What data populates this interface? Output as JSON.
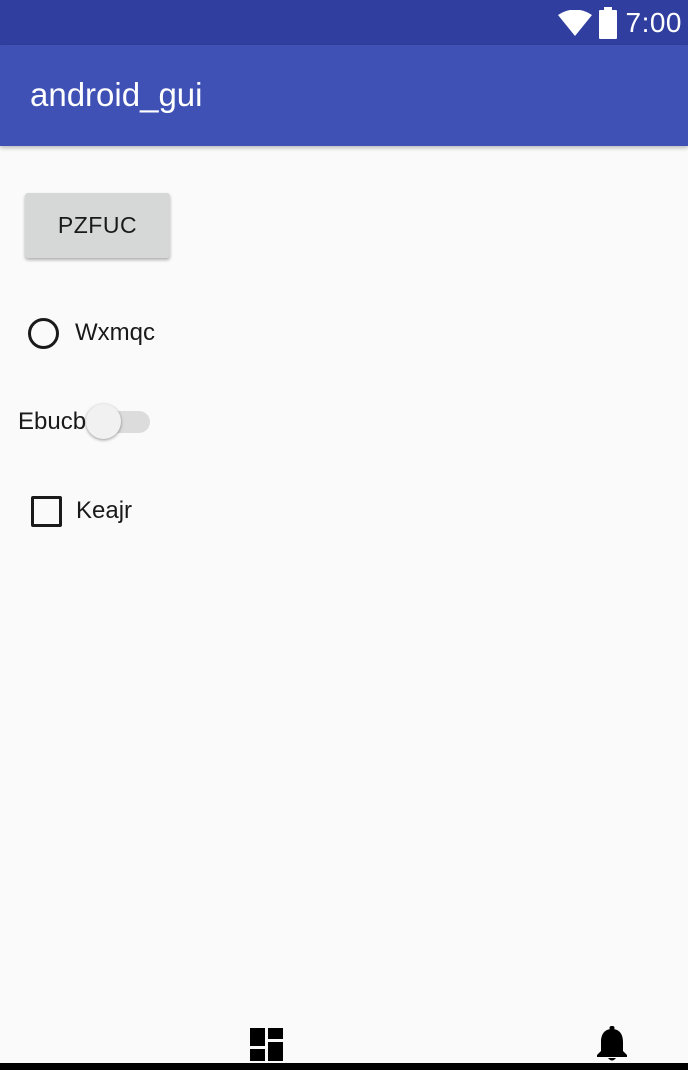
{
  "status_bar": {
    "time": "7:00",
    "icons": [
      "wifi-icon",
      "battery-icon"
    ],
    "background_color": "#303f9f"
  },
  "app_bar": {
    "title": "android_gui",
    "background_color": "#3f51b5"
  },
  "content": {
    "button_label": "PZFUC",
    "radio_label": "Wxmqc",
    "radio_checked": false,
    "switch_label": "Ebucb",
    "switch_on": false,
    "checkbox_label": "Keajr",
    "checkbox_checked": false
  },
  "bottom_nav": {
    "icons": [
      "dashboard-icon",
      "bell-icon"
    ]
  }
}
